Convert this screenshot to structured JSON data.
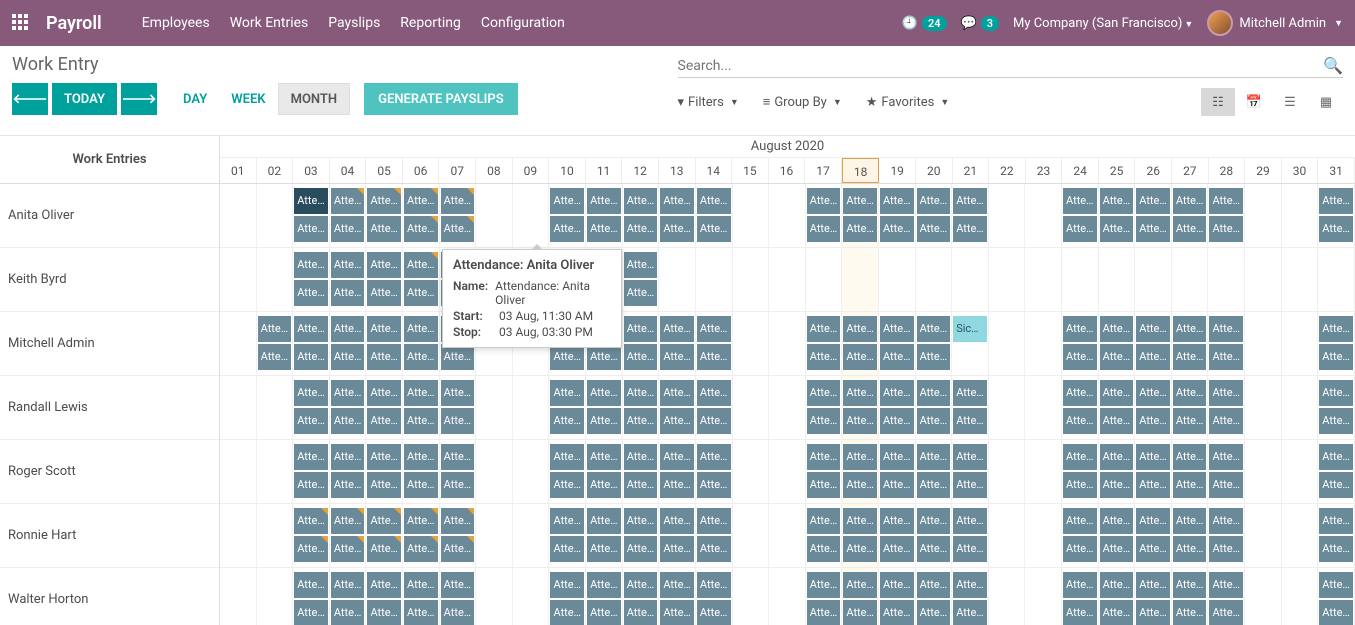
{
  "nav": {
    "brand": "Payroll",
    "links": [
      "Employees",
      "Work Entries",
      "Payslips",
      "Reporting",
      "Configuration"
    ],
    "badge_clock": "24",
    "badge_chat": "3",
    "company": "My Company (San Francisco)",
    "user": "Mitchell Admin"
  },
  "page": {
    "title": "Work Entry",
    "today": "TODAY",
    "ranges": [
      "DAY",
      "WEEK",
      "MONTH"
    ],
    "active_range": 2,
    "generate": "GENERATE PAYSLIPS",
    "search_placeholder": "Search...",
    "filters": "Filters",
    "groupby": "Group By",
    "favorites": "Favorites"
  },
  "gantt": {
    "left_header": "Work Entries",
    "month_label": "August 2020",
    "today_index": 17,
    "days": [
      "01",
      "02",
      "03",
      "04",
      "05",
      "06",
      "07",
      "08",
      "09",
      "10",
      "11",
      "12",
      "13",
      "14",
      "15",
      "16",
      "17",
      "18",
      "19",
      "20",
      "21",
      "22",
      "23",
      "24",
      "25",
      "26",
      "27",
      "28",
      "29",
      "30",
      "31"
    ],
    "employees": [
      {
        "name": "Anita Oliver",
        "pattern": "A",
        "flags_row1": [
          3,
          4,
          5,
          6
        ],
        "flags_row2": [
          5,
          6
        ],
        "selected_day": 2
      },
      {
        "name": "Keith Byrd",
        "pattern": "B",
        "flags_row1": [
          5,
          6
        ],
        "flags_row2": []
      },
      {
        "name": "Mitchell Admin",
        "pattern": "C",
        "flags_row1": [],
        "flags_row2": [],
        "sick_day": 20
      },
      {
        "name": "Randall Lewis",
        "pattern": "A",
        "flags_row1": [],
        "flags_row2": []
      },
      {
        "name": "Roger Scott",
        "pattern": "A",
        "flags_row1": [],
        "flags_row2": []
      },
      {
        "name": "Ronnie Hart",
        "pattern": "A",
        "flags_row1": [
          2,
          3,
          4,
          5,
          6
        ],
        "flags_row2": [
          2,
          3,
          4,
          5,
          6
        ]
      },
      {
        "name": "Walter Horton",
        "pattern": "A",
        "flags_row1": [],
        "flags_row2": []
      }
    ],
    "entry_label": "Atte…",
    "sick_label": "Sick Time …"
  },
  "tooltip": {
    "title": "Attendance: Anita Oliver",
    "name_label": "Name:",
    "name_value": "Attendance: Anita Oliver",
    "start_label": "Start:",
    "start_value": "03 Aug, 11:30 AM",
    "stop_label": "Stop:",
    "stop_value": "03 Aug, 03:30 PM"
  },
  "patterns": {
    "A": [
      false,
      false,
      true,
      true,
      true,
      true,
      true,
      false,
      false,
      true,
      true,
      true,
      true,
      true,
      false,
      false,
      true,
      true,
      true,
      true,
      true,
      false,
      false,
      true,
      true,
      true,
      true,
      true,
      false,
      false,
      true
    ],
    "B": [
      false,
      false,
      true,
      true,
      true,
      true,
      true,
      false,
      false,
      true,
      true,
      true,
      false,
      false,
      false,
      false,
      false,
      false,
      false,
      false,
      false,
      false,
      false,
      false,
      false,
      false,
      false,
      false,
      false,
      false,
      false
    ],
    "C": [
      false,
      true,
      true,
      true,
      true,
      true,
      true,
      false,
      false,
      true,
      true,
      true,
      true,
      true,
      false,
      false,
      true,
      true,
      true,
      true,
      "sick",
      false,
      false,
      true,
      true,
      true,
      true,
      true,
      false,
      false,
      true
    ]
  }
}
